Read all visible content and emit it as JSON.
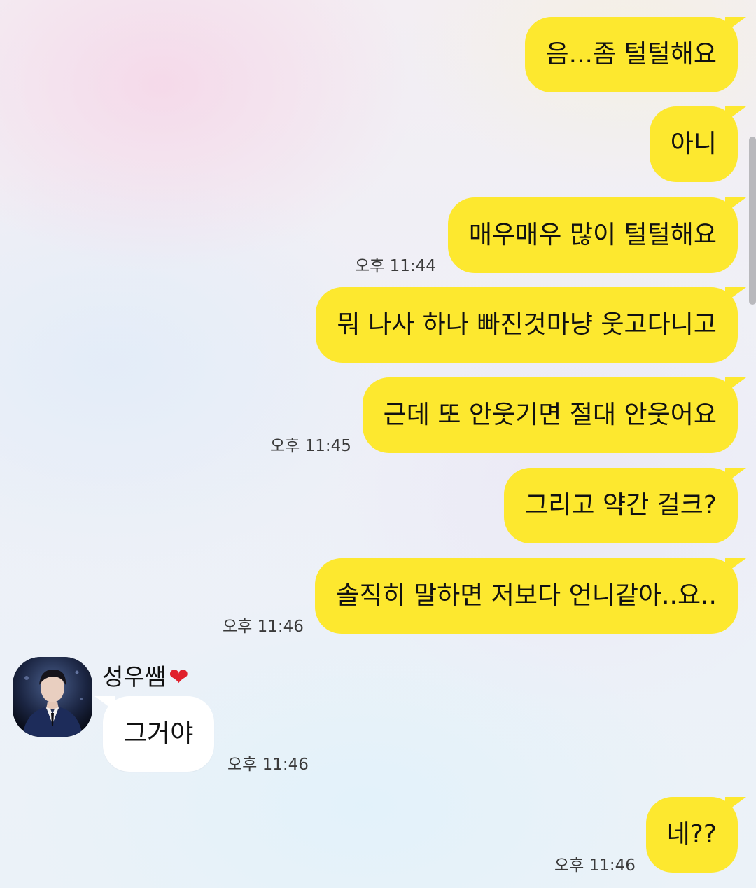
{
  "messages": {
    "m1": {
      "text": "음...좀 털털해요"
    },
    "m2": {
      "text": "아니"
    },
    "m3": {
      "text": "매우매우 많이 털털해요",
      "time": "오후 11:44"
    },
    "m4": {
      "text": "뭐 나사 하나 빠진것마냥 웃고다니고"
    },
    "m5": {
      "text": "근데 또 안웃기면 절대 안웃어요",
      "time": "오후 11:45"
    },
    "m6": {
      "text": "그리고 약간 걸크?"
    },
    "m7": {
      "text": "솔직히 말하면 저보다 언니같아..요..",
      "time": "오후 11:46"
    },
    "reply": {
      "sender": "성우쌤",
      "sender_emoji": "❤",
      "text": "그거야",
      "time": "오후 11:46"
    },
    "m8": {
      "text": "네??",
      "time": "오후 11:46"
    }
  },
  "colors": {
    "my_bubble": "#fde82f",
    "their_bubble": "#ffffff",
    "heart": "#e0202c"
  }
}
